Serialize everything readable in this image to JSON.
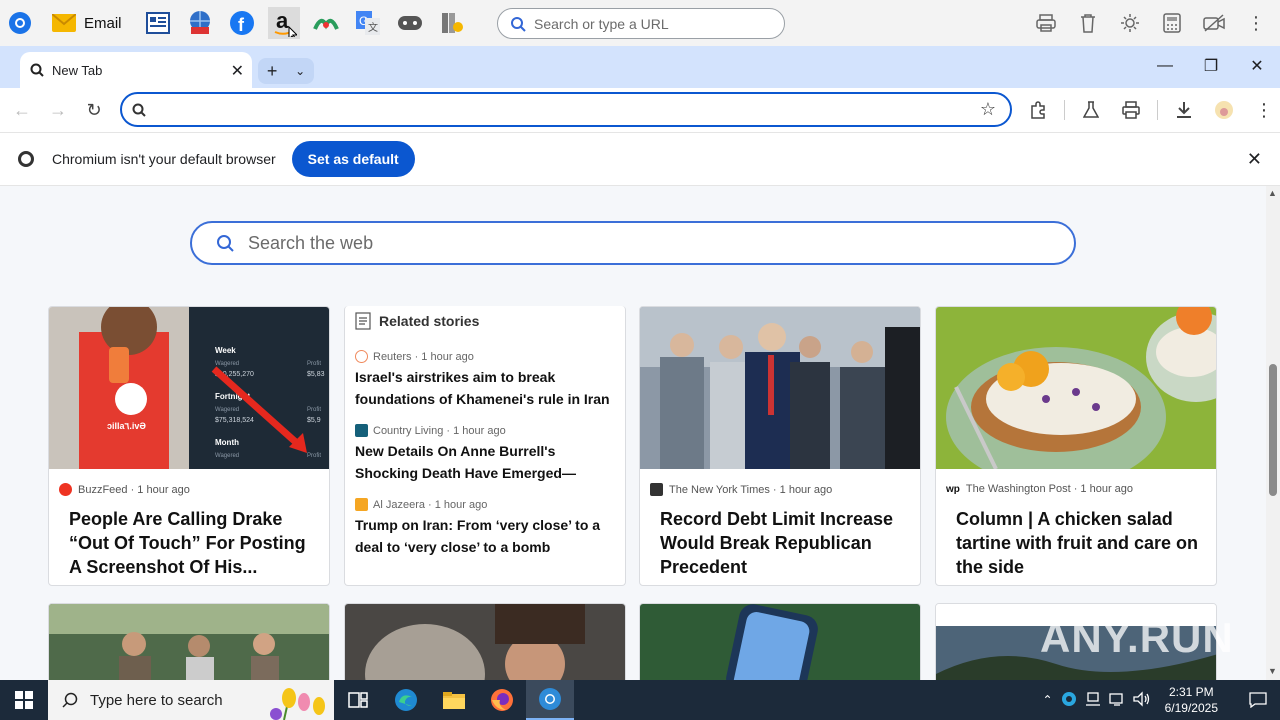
{
  "desktop_toolbar": {
    "email_label": "Email",
    "search_placeholder": "Search or type a URL"
  },
  "browser": {
    "tab_title": "New Tab",
    "omnibox_value": "",
    "infobar": {
      "message": "Chromium isn't your default browser",
      "button": "Set as default"
    }
  },
  "page": {
    "search_placeholder": "Search the web",
    "cards": [
      {
        "source": "BuzzFeed · 1 hour ago",
        "headline": "People Are Calling Drake “Out Of Touch” For Posting A Screenshot Of His..."
      },
      {
        "source": "The New York Times · 1 hour ago",
        "headline": "Record Debt Limit Increase Would Break Republican Precedent"
      },
      {
        "source": "The Washington Post · 1 hour ago",
        "headline": "Column | A chicken salad tartine with fruit and care on the side"
      }
    ],
    "related": {
      "title": "Related stories",
      "items": [
        {
          "source": "Reuters · 1 hour ago",
          "headline": "Israel's airstrikes aim to break foundations of Khamenei's rule in Iran"
        },
        {
          "source": "Country Living · 1 hour ago",
          "headline": "New Details On Anne Burrell's Shocking Death Have Emerged—Here's What We..."
        },
        {
          "source": "Al Jazeera · 1 hour ago",
          "headline": "Trump on Iran: From ‘very close’ to a deal to ‘very close’ to a bomb"
        }
      ]
    },
    "drake_image": {
      "labels": [
        "Week",
        "Fortnight",
        "Month"
      ],
      "sublabel": "Wagered",
      "profit_label": "Profit",
      "values": [
        "$10,255,270",
        "$75,318,524"
      ],
      "profit_values": [
        "$5,83",
        "$5,9"
      ],
      "shirt_text": "ɔilla٦.ivƏ"
    }
  },
  "taskbar": {
    "search_placeholder": "Type here to search",
    "time": "2:31 PM",
    "date": "6/19/2025"
  },
  "watermark": "ANY.RUN"
}
